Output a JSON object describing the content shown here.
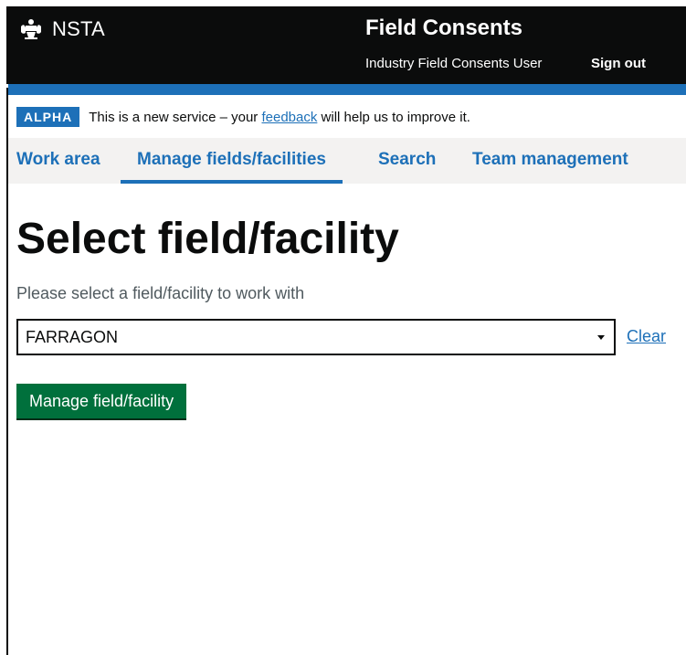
{
  "header": {
    "logo_text": "NSTA",
    "service_name": "Field Consents",
    "user_name": "Industry Field Consents User",
    "sign_out_label": "Sign out",
    "logo_icon": "crest-icon"
  },
  "phase_banner": {
    "tag": "ALPHA",
    "text_before": "This is a new service – your ",
    "link_text": "feedback",
    "text_after": " will help us to improve it."
  },
  "nav": {
    "items": [
      {
        "label": "Work area",
        "active": false
      },
      {
        "label": "Manage fields/facilities",
        "active": true
      },
      {
        "label": "Search",
        "active": false
      },
      {
        "label": "Team management",
        "active": false
      }
    ]
  },
  "main": {
    "title": "Select field/facility",
    "hint": "Please select a field/facility to work with",
    "select_value": "FARRAGON",
    "clear_label": "Clear",
    "button_label": "Manage field/facility"
  },
  "colors": {
    "header_bg": "#0b0c0c",
    "brand_blue": "#1d70b8",
    "button_green": "#00703c",
    "nav_bg": "#f3f2f1"
  }
}
